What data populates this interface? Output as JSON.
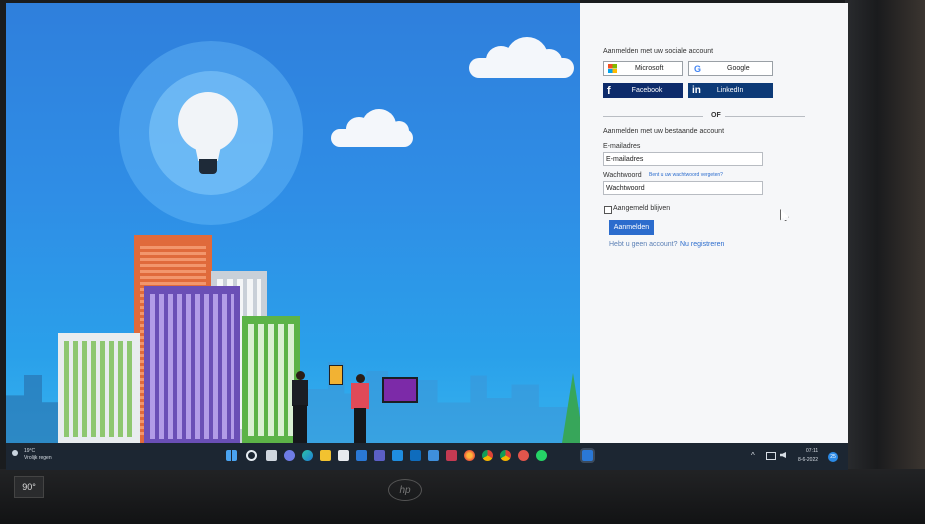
{
  "login": {
    "social_heading": "Aanmelden met uw sociale account",
    "microsoft": "Microsoft",
    "google": "Google",
    "facebook": "Facebook",
    "linkedin": "LinkedIn",
    "or": "OF",
    "existing_heading": "Aanmelden met uw bestaande account",
    "email_label": "E-mailadres",
    "email_placeholder": "E-mailadres",
    "password_label": "Wachtwoord",
    "forgot": "Bent u uw wachtwoord vergeten?",
    "password_placeholder": "Wachtwoord",
    "remember": "Aangemeld blijven",
    "submit": "Aanmelden",
    "no_account": "Hebt u geen account?",
    "register": "Nu registreren"
  },
  "taskbar": {
    "weather_temp": "19°C",
    "weather_desc": "Vrolijk regen",
    "clock_time": "07:11",
    "clock_date": "8-6-2022",
    "notification_count": "25"
  },
  "monitor": {
    "osd": "90°",
    "brand": "hp"
  },
  "colors": {
    "accent": "#2b6ccd",
    "facebook": "#0d2b6b",
    "linkedin": "#0d3a77"
  }
}
